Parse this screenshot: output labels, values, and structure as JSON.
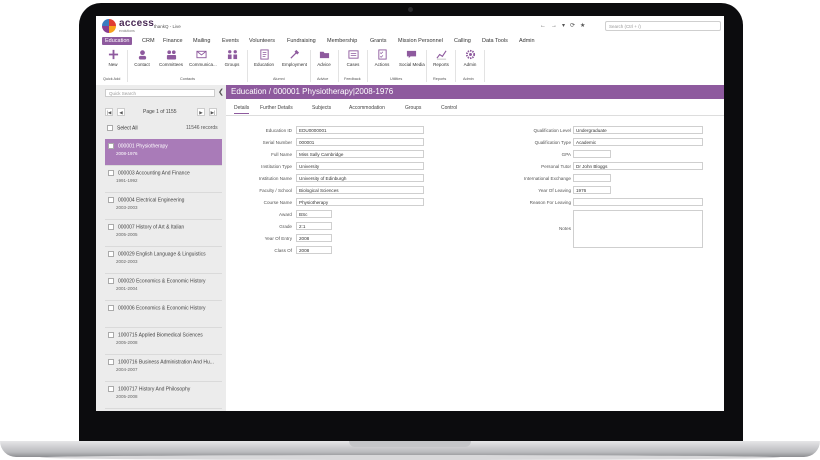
{
  "app": {
    "brand": "access",
    "brand_sub": "evolutions",
    "instance": "thankQ - Live",
    "nav_icons": [
      "←",
      "→",
      "▾",
      "⟳",
      "★"
    ],
    "search_placeholder": "Search (Ctrl + /)"
  },
  "menu": [
    "Education",
    "CRM",
    "Finance",
    "Mailing",
    "Events",
    "Volunteers",
    "Fundraising",
    "Membership",
    "Grants",
    "Mission Personnel",
    "Calling",
    "Data Tools",
    "Admin"
  ],
  "ribbon": {
    "buttons": [
      {
        "label": "New",
        "icon": "plus-icon"
      },
      {
        "label": "Contact",
        "icon": "contact-icon"
      },
      {
        "label": "Committees",
        "icon": "committees-icon"
      },
      {
        "label": "Communica...",
        "icon": "envelope-icon"
      },
      {
        "label": "Groups",
        "icon": "groups-icon"
      },
      {
        "label": "Education",
        "icon": "education-icon"
      },
      {
        "label": "Employment",
        "icon": "tools-icon"
      },
      {
        "label": "Advice",
        "icon": "folder-icon"
      },
      {
        "label": "Cases",
        "icon": "cases-icon"
      },
      {
        "label": "Actions",
        "icon": "checklist-icon"
      },
      {
        "label": "Social Media",
        "icon": "speech-icon"
      },
      {
        "label": "Reports",
        "icon": "chart-icon"
      },
      {
        "label": "Admin",
        "icon": "gear-icon"
      }
    ],
    "groups": [
      "Quick Add",
      "Contacts",
      "Alumni",
      "Advice",
      "Feedback",
      "Utilities",
      "Reports",
      "Admin"
    ]
  },
  "sidebar": {
    "search_placeholder": "Quick Search",
    "pager": "Page 1 of 1155",
    "select_all": "Select All",
    "records_count": "11546 records",
    "records": [
      {
        "title": "000001 Physiotherapy",
        "years": "2008-1976",
        "active": true
      },
      {
        "title": "000003 Accounting And Finance",
        "years": "1991-1992"
      },
      {
        "title": "000004 Electrical Engineering",
        "years": "2003-2003"
      },
      {
        "title": "000007 History of Art & Italian",
        "years": "2005-2005"
      },
      {
        "title": "000029 English Language & Linguistics",
        "years": "2002-2003"
      },
      {
        "title": "000020 Economics & Economic History",
        "years": "2001-2004"
      },
      {
        "title": "000006 Economics & Economic History",
        "years": ""
      },
      {
        "title": "1000715 Applied Biomedical Sciences",
        "years": "2005-2008"
      },
      {
        "title": "1000716 Business Administration And Hu...",
        "years": "2004-2007"
      },
      {
        "title": "1000717 History And Philosophy",
        "years": "2005-2008"
      }
    ]
  },
  "main": {
    "title": "Education / 000001 Physiotherapy|2008-1976",
    "tabs": [
      "Details",
      "Further Details",
      "Subjects",
      "Accommodation",
      "Groups",
      "Control"
    ],
    "left_fields": [
      {
        "label": "Education ID",
        "value": "EDU0000001"
      },
      {
        "label": "Serial Number",
        "value": "000001"
      },
      {
        "label": "Full Name",
        "value": "Miss Sally Cambridge"
      },
      {
        "label": "Institution Type",
        "value": "University"
      },
      {
        "label": "Institution Name",
        "value": "University of Edinburgh"
      },
      {
        "label": "Faculty / School",
        "value": "Biological Sciences"
      },
      {
        "label": "Course Name",
        "value": "Physiotherapy"
      },
      {
        "label": "Award",
        "value": "BSc"
      },
      {
        "label": "Grade",
        "value": "2:1"
      },
      {
        "label": "Year Of Entry",
        "value": "2008"
      },
      {
        "label": "Class Of",
        "value": "2008"
      }
    ],
    "right_fields": [
      {
        "label": "Qualification Level",
        "value": "Undergraduate"
      },
      {
        "label": "Qualification Type",
        "value": "Academic"
      },
      {
        "label": "GPA",
        "value": ""
      },
      {
        "label": "Personal Tutor",
        "value": "Dr John Bloggs"
      },
      {
        "label": "International Exchange",
        "value": ""
      },
      {
        "label": "Year Of Leaving",
        "value": "1976"
      },
      {
        "label": "Reason For Leaving",
        "value": ""
      },
      {
        "label": "Notes",
        "value": ""
      }
    ]
  }
}
